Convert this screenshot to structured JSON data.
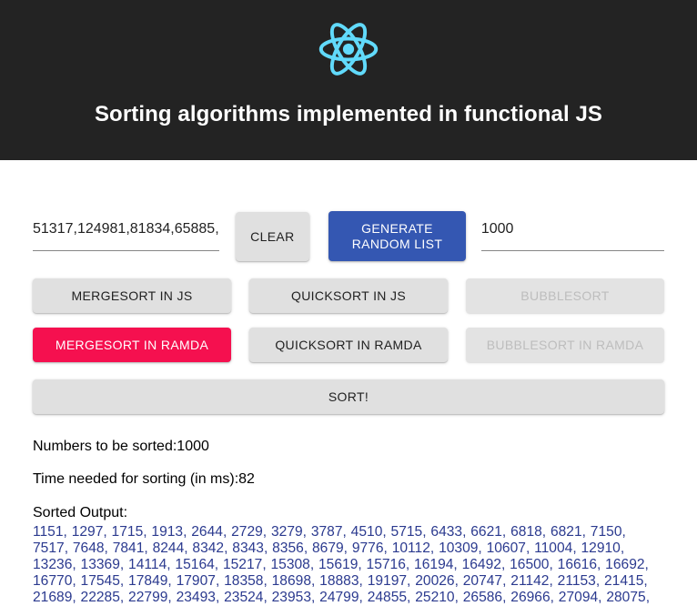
{
  "header": {
    "logo_icon": "react-atom-logo",
    "logo_color": "#61dafb",
    "background_color": "#232323",
    "title": "Sorting algorithms implemented in functional JS"
  },
  "controls": {
    "list_input": {
      "value": "51317,124981,81834,65885,",
      "placeholder": ""
    },
    "clear_button": "CLEAR",
    "generate_button": "GENERATE RANDOM LIST",
    "generate_button_line1": "GENERATE",
    "generate_button_line2": "RANDOM LIST",
    "generate_button_color": "#3457b2",
    "count_input": {
      "value": "1000",
      "placeholder": ""
    }
  },
  "algorithms": {
    "selected_color": "#f5104f",
    "row1": [
      {
        "label": "MERGESORT IN JS",
        "selected": false,
        "disabled": false
      },
      {
        "label": "QUICKSORT IN JS",
        "selected": false,
        "disabled": false
      },
      {
        "label": "BUBBLESORT",
        "selected": false,
        "disabled": true
      }
    ],
    "row2": [
      {
        "label": "MERGESORT IN RAMDA",
        "selected": true,
        "disabled": false
      },
      {
        "label": "QUICKSORT IN RAMDA",
        "selected": false,
        "disabled": false
      },
      {
        "label": "BUBBLESORT IN RAMDA",
        "selected": false,
        "disabled": true
      }
    ],
    "sort_button": "SORT!"
  },
  "results": {
    "numbers_to_be_sorted": "Numbers to be sorted:1000",
    "time_needed": "Time needed for sorting (in ms):82",
    "sorted_output_label": "Sorted Output:",
    "sorted_output_values": "1151, 1297, 1715, 1913, 2644, 2729, 3279, 3787, 4510, 5715, 6433, 6621, 6818, 6821, 7150, 7517, 7648, 7841, 8244, 8342, 8343, 8356, 8679, 9776, 10112, 10309, 10607, 11004, 12910, 13236, 13369, 14114, 15164, 15217, 15308, 15619, 15716, 16194, 16492, 16500, 16616, 16692, 16770, 17545, 17849, 17907, 18358, 18698, 18883, 19197, 20026, 20747, 21142, 21153, 21415, 21689, 22285, 22799, 23493, 23524, 23953, 24799, 24855, 25210, 26586, 26966, 27094, 28075,"
  }
}
